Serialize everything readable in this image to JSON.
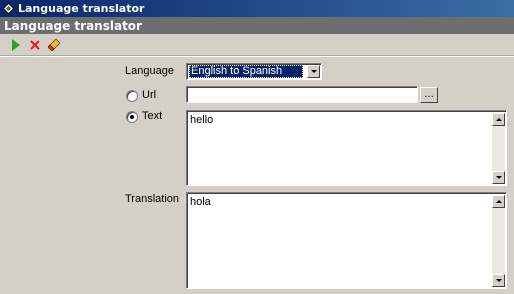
{
  "window": {
    "title": "Language translator"
  },
  "header": {
    "title": "Language translator"
  },
  "toolbar": {
    "run_icon": "play-icon",
    "cancel_icon": "close-icon",
    "clear_icon": "eraser-icon",
    "colors": {
      "run": "#2aa12a",
      "cancel": "#e21b1b",
      "clear": "#d83a2a"
    }
  },
  "form": {
    "language_label": "Language",
    "language_value": "English to Spanish",
    "url_label": "Url",
    "url_value": "",
    "browse_label": "...",
    "text_label": "Text",
    "text_value": "hello",
    "translation_label": "Translation",
    "translation_value": "hola",
    "selected_source": "text"
  }
}
